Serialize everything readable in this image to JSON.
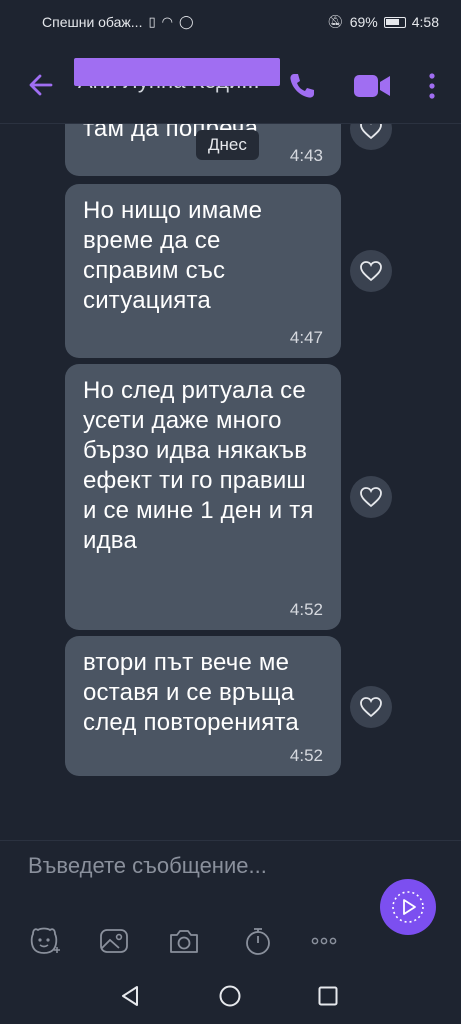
{
  "status_bar": {
    "carrier": "Спешни обаж...",
    "battery": "69%",
    "time": "4:58"
  },
  "header": {
    "contact_name": "Ани Лунна Коди..."
  },
  "date_chip": "Днес",
  "messages": [
    {
      "text": "там да попреча",
      "time": "4:43"
    },
    {
      "text": "Но нищо имаме време да се справим със ситуацията",
      "time": "4:47"
    },
    {
      "text": "Но след ритуала се усети даже много бързо идва някакъв ефект ти го правиш и се мине 1 ден и тя идва",
      "time": "4:52"
    },
    {
      "text": "втори път вече ме оставя и се връща след повторенията",
      "time": "4:52"
    }
  ],
  "input": {
    "placeholder": "Въведете съобщение..."
  },
  "colors": {
    "accent": "#7c4ff0",
    "bubble": "#4b5563",
    "background": "#1e2430"
  },
  "icons": {
    "back": "arrow-left-icon",
    "call": "phone-icon",
    "video": "video-camera-icon",
    "more": "more-vertical-icon",
    "like": "heart-icon",
    "send": "send-icon",
    "sticker": "sticker-icon",
    "gallery": "gallery-icon",
    "camera": "camera-icon",
    "timer": "timer-icon",
    "more_options": "more-horizontal-icon"
  }
}
